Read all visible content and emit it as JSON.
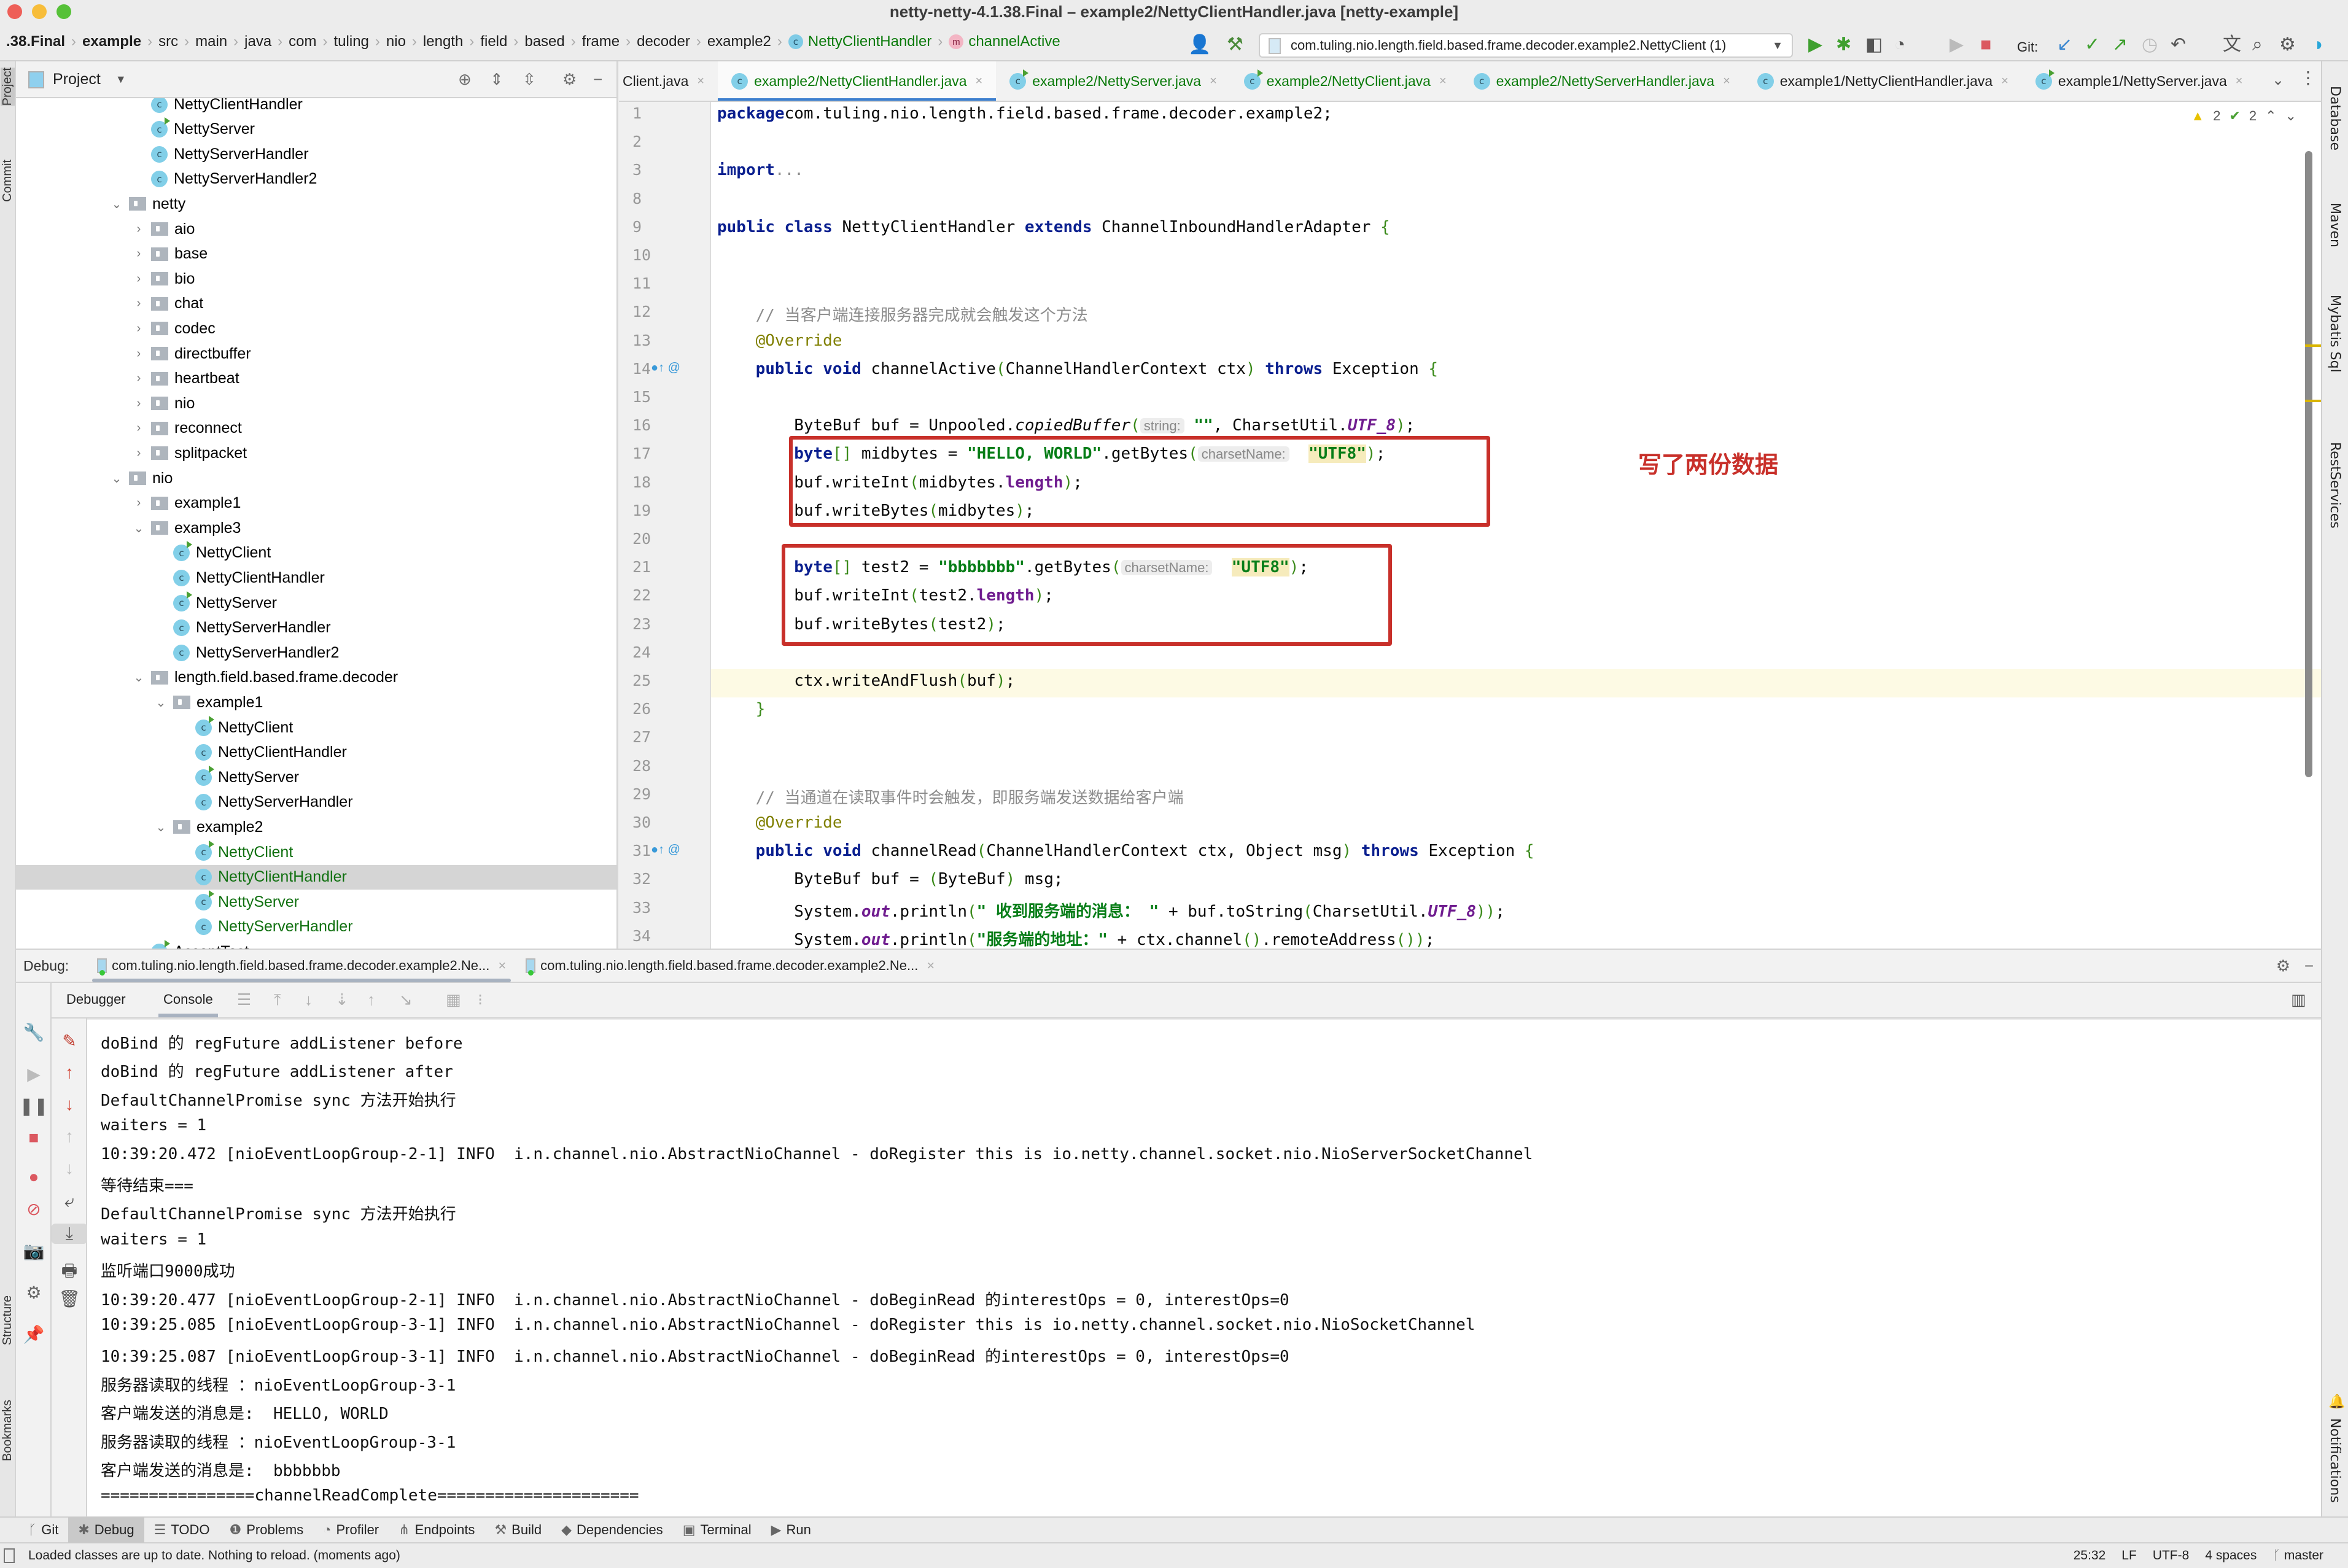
{
  "window": {
    "title": "netty-netty-4.1.38.Final – example2/NettyClientHandler.java [netty-example]",
    "colors": {
      "close": "#ee5f58",
      "minimize": "#f7bd3a",
      "maximize": "#56c138"
    }
  },
  "breadcrumb": [
    {
      "label": ".38.Final",
      "style": "bold"
    },
    {
      "label": "example",
      "style": "bold"
    },
    {
      "label": "src"
    },
    {
      "label": "main"
    },
    {
      "label": "java"
    },
    {
      "label": "com"
    },
    {
      "label": "tuling"
    },
    {
      "label": "nio"
    },
    {
      "label": "length"
    },
    {
      "label": "field"
    },
    {
      "label": "based"
    },
    {
      "label": "frame"
    },
    {
      "label": "decoder"
    },
    {
      "label": "example2"
    },
    {
      "label": "NettyClientHandler",
      "style": "green",
      "icon": "class-icon"
    },
    {
      "label": "channelActive",
      "style": "green",
      "icon": "method-icon"
    }
  ],
  "toolbar": {
    "run_config": "com.tuling.nio.length.field.based.frame.decoder.example2.NettyClient (1)",
    "git_label": "Git:"
  },
  "project_panel": {
    "title": "Project",
    "tree": [
      {
        "label": "NettyClientHandler",
        "type": "class",
        "depth": 2
      },
      {
        "label": "NettyServer",
        "type": "class-run",
        "depth": 2
      },
      {
        "label": "NettyServerHandler",
        "type": "class",
        "depth": 2
      },
      {
        "label": "NettyServerHandler2",
        "type": "class",
        "depth": 2
      },
      {
        "label": "netty",
        "type": "folder",
        "depth": 1,
        "expanded": true
      },
      {
        "label": "aio",
        "type": "folder",
        "depth": 2,
        "expanded": false
      },
      {
        "label": "base",
        "type": "folder",
        "depth": 2,
        "expanded": false
      },
      {
        "label": "bio",
        "type": "folder",
        "depth": 2,
        "expanded": false
      },
      {
        "label": "chat",
        "type": "folder",
        "depth": 2,
        "expanded": false
      },
      {
        "label": "codec",
        "type": "folder",
        "depth": 2,
        "expanded": false
      },
      {
        "label": "directbuffer",
        "type": "folder",
        "depth": 2,
        "expanded": false
      },
      {
        "label": "heartbeat",
        "type": "folder",
        "depth": 2,
        "expanded": false
      },
      {
        "label": "nio",
        "type": "folder",
        "depth": 2,
        "expanded": false
      },
      {
        "label": "reconnect",
        "type": "folder",
        "depth": 2,
        "expanded": false
      },
      {
        "label": "splitpacket",
        "type": "folder",
        "depth": 2,
        "expanded": false
      },
      {
        "label": "nio",
        "type": "folder",
        "depth": 1,
        "expanded": true
      },
      {
        "label": "example1",
        "type": "folder",
        "depth": 2,
        "expanded": false
      },
      {
        "label": "example3",
        "type": "folder",
        "depth": 2,
        "expanded": true
      },
      {
        "label": "NettyClient",
        "type": "class-run",
        "depth": 3
      },
      {
        "label": "NettyClientHandler",
        "type": "class",
        "depth": 3
      },
      {
        "label": "NettyServer",
        "type": "class-run",
        "depth": 3
      },
      {
        "label": "NettyServerHandler",
        "type": "class",
        "depth": 3
      },
      {
        "label": "NettyServerHandler2",
        "type": "class",
        "depth": 3
      },
      {
        "label": "length.field.based.frame.decoder",
        "type": "folder",
        "depth": 2,
        "expanded": true
      },
      {
        "label": "example1",
        "type": "folder",
        "depth": 3,
        "expanded": true
      },
      {
        "label": "NettyClient",
        "type": "class-run",
        "depth": 4
      },
      {
        "label": "NettyClientHandler",
        "type": "class",
        "depth": 4
      },
      {
        "label": "NettyServer",
        "type": "class-run",
        "depth": 4
      },
      {
        "label": "NettyServerHandler",
        "type": "class",
        "depth": 4
      },
      {
        "label": "example2",
        "type": "folder",
        "depth": 3,
        "expanded": true
      },
      {
        "label": "NettyClient",
        "type": "class-run",
        "depth": 4,
        "modified": true
      },
      {
        "label": "NettyClientHandler",
        "type": "class",
        "depth": 4,
        "modified": true,
        "selected": true
      },
      {
        "label": "NettyServer",
        "type": "class-run",
        "depth": 4,
        "modified": true
      },
      {
        "label": "NettyServerHandler",
        "type": "class",
        "depth": 4,
        "modified": true
      },
      {
        "label": "AcceptTest",
        "type": "class-run",
        "depth": 2
      }
    ]
  },
  "editor_tabs": [
    {
      "label": "Client.java",
      "modified": false,
      "active": false,
      "icon": "none"
    },
    {
      "label": "example2/NettyClientHandler.java",
      "modified": true,
      "active": true,
      "icon": "class"
    },
    {
      "label": "example2/NettyServer.java",
      "modified": true,
      "active": false,
      "icon": "class-run"
    },
    {
      "label": "example2/NettyClient.java",
      "modified": true,
      "active": false,
      "icon": "class-run"
    },
    {
      "label": "example2/NettyServerHandler.java",
      "modified": true,
      "active": false,
      "icon": "class"
    },
    {
      "label": "example1/NettyClientHandler.java",
      "modified": false,
      "active": false,
      "icon": "class"
    },
    {
      "label": "example1/NettyServer.java",
      "modified": false,
      "active": false,
      "icon": "class-run"
    }
  ],
  "editor": {
    "inspections": {
      "warnings": "2",
      "typos": "2"
    },
    "current_line": 25,
    "annotation": "写了两份数据",
    "lines": [
      {
        "n": "1",
        "tokens": [
          [
            "kw",
            "package"
          ],
          [
            "",
            "com.tuling.nio.length.field.based.frame.decoder.example2;"
          ]
        ]
      },
      {
        "n": "2",
        "tokens": []
      },
      {
        "n": "3",
        "tokens": [
          [
            "kw",
            "import"
          ],
          [
            "",
            ""
          ],
          [
            "cmt",
            "..."
          ]
        ]
      },
      {
        "n": "8",
        "tokens": []
      },
      {
        "n": "9",
        "tokens": [
          [
            "kw",
            "public class"
          ],
          [
            "",
            " NettyClientHandler "
          ],
          [
            "kw",
            "extends"
          ],
          [
            "",
            " ChannelInboundHandlerAdapter "
          ],
          [
            "paren",
            "{"
          ]
        ]
      },
      {
        "n": "10",
        "tokens": []
      },
      {
        "n": "11",
        "tokens": []
      },
      {
        "n": "12",
        "tokens": [
          [
            "cmt",
            "    // 当客户端连接服务器完成就会触发这个方法"
          ]
        ]
      },
      {
        "n": "13",
        "tokens": [
          [
            "ann",
            "    @Override"
          ]
        ]
      },
      {
        "n": "14",
        "tokens": [
          [
            "",
            "    "
          ],
          [
            "kw",
            "public void"
          ],
          [
            "",
            " channelActive"
          ],
          [
            "paren",
            "("
          ],
          [
            "",
            "ChannelHandlerContext ctx"
          ],
          [
            "paren",
            ")"
          ],
          [
            "",
            " "
          ],
          [
            "kw",
            "throws"
          ],
          [
            "",
            " Exception "
          ],
          [
            "paren",
            "{"
          ]
        ]
      },
      {
        "n": "15",
        "tokens": []
      },
      {
        "n": "16",
        "tokens": [
          [
            "",
            "        ByteBuf buf = Unpooled."
          ],
          [
            "ital",
            "copiedBuffer"
          ],
          [
            "paren",
            "("
          ],
          [
            "hint",
            "string:"
          ],
          [
            "str",
            " \"\""
          ],
          [
            "",
            ", CharsetUtil."
          ],
          [
            "fld ital",
            "UTF_8"
          ],
          [
            "paren",
            ")"
          ],
          [
            "",
            ";"
          ]
        ]
      },
      {
        "n": "17",
        "tokens": [
          [
            "",
            "        "
          ],
          [
            "kw",
            "byte"
          ],
          [
            "paren",
            "[]"
          ],
          [
            "",
            " midbytes = "
          ],
          [
            "str",
            "\"HELLO, WORLD\""
          ],
          [
            "",
            ".getBytes"
          ],
          [
            "paren",
            "("
          ],
          [
            "hint",
            "charsetName:"
          ],
          [
            "",
            "  "
          ],
          [
            "str hl-utf",
            "\"UTF8\""
          ],
          [
            "paren",
            ")"
          ],
          [
            "",
            ";"
          ]
        ]
      },
      {
        "n": "18",
        "tokens": [
          [
            "",
            "        buf.writeInt"
          ],
          [
            "paren",
            "("
          ],
          [
            "",
            "midbytes."
          ],
          [
            "fld",
            "length"
          ],
          [
            "paren",
            ")"
          ],
          [
            "",
            ";"
          ]
        ]
      },
      {
        "n": "19",
        "tokens": [
          [
            "",
            "        buf.writeBytes"
          ],
          [
            "paren",
            "("
          ],
          [
            "",
            "midbytes"
          ],
          [
            "paren",
            ")"
          ],
          [
            "",
            ";"
          ]
        ]
      },
      {
        "n": "20",
        "tokens": []
      },
      {
        "n": "21",
        "tokens": [
          [
            "",
            "        "
          ],
          [
            "kw",
            "byte"
          ],
          [
            "paren",
            "[]"
          ],
          [
            "",
            " test2 = "
          ],
          [
            "str",
            "\"bbbbbbb\""
          ],
          [
            "",
            ".getBytes"
          ],
          [
            "paren",
            "("
          ],
          [
            "hint",
            "charsetName:"
          ],
          [
            "",
            "  "
          ],
          [
            "str hl-utf",
            "\"UTF8\""
          ],
          [
            "paren",
            ")"
          ],
          [
            "",
            ";"
          ]
        ]
      },
      {
        "n": "22",
        "tokens": [
          [
            "",
            "        buf.writeInt"
          ],
          [
            "paren",
            "("
          ],
          [
            "",
            "test2."
          ],
          [
            "fld",
            "length"
          ],
          [
            "paren",
            ")"
          ],
          [
            "",
            ";"
          ]
        ]
      },
      {
        "n": "23",
        "tokens": [
          [
            "",
            "        buf.writeBytes"
          ],
          [
            "paren",
            "("
          ],
          [
            "",
            "test2"
          ],
          [
            "paren",
            ")"
          ],
          [
            "",
            ";"
          ]
        ]
      },
      {
        "n": "24",
        "tokens": []
      },
      {
        "n": "25",
        "tokens": [
          [
            "",
            "        ctx.writeAndFlush"
          ],
          [
            "paren",
            "("
          ],
          [
            "",
            "buf"
          ],
          [
            "paren",
            ")"
          ],
          [
            "",
            ";"
          ]
        ]
      },
      {
        "n": "26",
        "tokens": [
          [
            "",
            "    "
          ],
          [
            "paren",
            "}"
          ]
        ]
      },
      {
        "n": "27",
        "tokens": []
      },
      {
        "n": "28",
        "tokens": []
      },
      {
        "n": "29",
        "tokens": [
          [
            "cmt",
            "    // 当通道在读取事件时会触发，即服务端发送数据给客户端"
          ]
        ]
      },
      {
        "n": "30",
        "tokens": [
          [
            "ann",
            "    @Override"
          ]
        ]
      },
      {
        "n": "31",
        "tokens": [
          [
            "",
            "    "
          ],
          [
            "kw",
            "public void"
          ],
          [
            "",
            " channelRead"
          ],
          [
            "paren",
            "("
          ],
          [
            "",
            "ChannelHandlerContext ctx, Object msg"
          ],
          [
            "paren",
            ")"
          ],
          [
            "",
            " "
          ],
          [
            "kw",
            "throws"
          ],
          [
            "",
            " Exception "
          ],
          [
            "paren",
            "{"
          ]
        ]
      },
      {
        "n": "32",
        "tokens": [
          [
            "",
            "        ByteBuf buf = "
          ],
          [
            "paren",
            "("
          ],
          [
            "",
            "ByteBuf"
          ],
          [
            "paren",
            ")"
          ],
          [
            "",
            " msg;"
          ]
        ]
      },
      {
        "n": "33",
        "tokens": [
          [
            "",
            "        System."
          ],
          [
            "fld ital",
            "out"
          ],
          [
            "",
            ".println"
          ],
          [
            "paren",
            "("
          ],
          [
            "str",
            "\" 收到服务端的消息： \""
          ],
          [
            "",
            " + buf.toString"
          ],
          [
            "paren",
            "("
          ],
          [
            "",
            "CharsetUtil."
          ],
          [
            "fld ital",
            "UTF_8"
          ],
          [
            "paren",
            "))"
          ],
          [
            "",
            ";"
          ]
        ]
      },
      {
        "n": "34",
        "tokens": [
          [
            "",
            "        System."
          ],
          [
            "fld ital",
            "out"
          ],
          [
            "",
            ".println"
          ],
          [
            "paren",
            "("
          ],
          [
            "str",
            "\"服务端的地址：\""
          ],
          [
            "",
            " + ctx.channel"
          ],
          [
            "paren",
            "()"
          ],
          [
            "",
            ".remoteAddress"
          ],
          [
            "paren",
            "())"
          ],
          [
            "",
            ";"
          ]
        ]
      }
    ]
  },
  "right_stripe": [
    "Database",
    "Maven",
    "Mybatis Sql",
    "RestServices"
  ],
  "right_stripe_bottom": "Notifications",
  "left_stripe": [
    "Project",
    "Commit"
  ],
  "left_stripe_bottom": [
    "Structure",
    "Bookmarks"
  ],
  "debug": {
    "label": "Debug:",
    "sessions": [
      {
        "label": "com.tuling.nio.length.field.based.frame.decoder.example2.Ne...",
        "active": true
      },
      {
        "label": "com.tuling.nio.length.field.based.frame.decoder.example2.Ne...",
        "active": false
      }
    ],
    "tabs": [
      {
        "label": "Debugger",
        "active": false
      },
      {
        "label": "Console",
        "active": true
      }
    ],
    "console": [
      "doBind 的 regFuture addListener before",
      "doBind 的 regFuture addListener after",
      "DefaultChannelPromise sync 方法开始执行",
      "waiters = 1",
      "10:39:20.472 [nioEventLoopGroup-2-1] INFO  i.n.channel.nio.AbstractNioChannel - doRegister this is io.netty.channel.socket.nio.NioServerSocketChannel",
      "等待结束===",
      "DefaultChannelPromise sync 方法开始执行",
      "waiters = 1",
      "监听端口9000成功",
      "10:39:20.477 [nioEventLoopGroup-2-1] INFO  i.n.channel.nio.AbstractNioChannel - doBeginRead 的interestOps = 0, interestOps=0",
      "10:39:25.085 [nioEventLoopGroup-3-1] INFO  i.n.channel.nio.AbstractNioChannel - doRegister this is io.netty.channel.socket.nio.NioSocketChannel",
      "10:39:25.087 [nioEventLoopGroup-3-1] INFO  i.n.channel.nio.AbstractNioChannel - doBeginRead 的interestOps = 0, interestOps=0",
      "服务器读取的线程 ：nioEventLoopGroup-3-1",
      "客户端发送的消息是:  HELLO, WORLD",
      "服务器读取的线程 ：nioEventLoopGroup-3-1",
      "客户端发送的消息是:  bbbbbbb",
      "================channelReadComplete====================="
    ]
  },
  "tool_windows": [
    {
      "label": "Git",
      "icon": "git-branch-icon",
      "glyph": "ᚴ"
    },
    {
      "label": "Debug",
      "icon": "bug-icon",
      "glyph": "✱",
      "active": true
    },
    {
      "label": "TODO",
      "icon": "list-icon",
      "glyph": "☰"
    },
    {
      "label": "Problems",
      "icon": "problems-icon",
      "glyph": "❶"
    },
    {
      "label": "Profiler",
      "icon": "profiler-icon",
      "glyph": "◔"
    },
    {
      "label": "Endpoints",
      "icon": "endpoints-icon",
      "glyph": "⋔"
    },
    {
      "label": "Build",
      "icon": "hammer-icon",
      "glyph": "⚒"
    },
    {
      "label": "Dependencies",
      "icon": "dependencies-icon",
      "glyph": "◆"
    },
    {
      "label": "Terminal",
      "icon": "terminal-icon",
      "glyph": "▣"
    },
    {
      "label": "Run",
      "icon": "run-icon",
      "glyph": "▶"
    }
  ],
  "status": {
    "message": "Loaded classes are up to date. Nothing to reload. (moments ago)",
    "position": "25:32",
    "line_sep": "LF",
    "encoding": "UTF-8",
    "indent": "4 spaces",
    "branch": "master"
  }
}
